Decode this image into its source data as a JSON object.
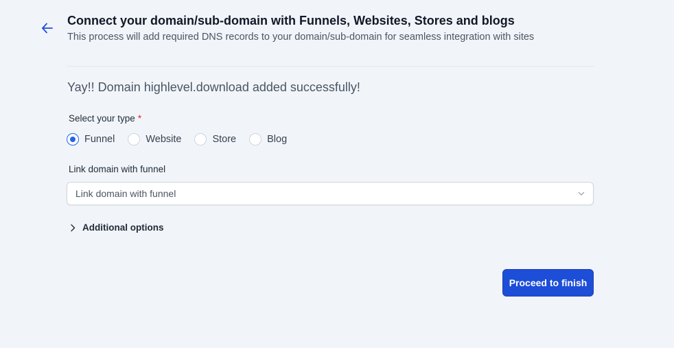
{
  "header": {
    "back_icon": "arrow-left-icon",
    "title": "Connect your domain/sub-domain with Funnels, Websites, Stores and blogs",
    "subtitle": "This process will add required DNS records to your domain/sub-domain for seamless integration with sites"
  },
  "success_message": "Yay!! Domain highlevel.download added successfully!",
  "type_select": {
    "label": "Select your type",
    "required_mark": "*",
    "options": [
      {
        "label": "Funnel",
        "selected": true
      },
      {
        "label": "Website",
        "selected": false
      },
      {
        "label": "Store",
        "selected": false
      },
      {
        "label": "Blog",
        "selected": false
      }
    ]
  },
  "link_domain": {
    "label": "Link domain with funnel",
    "placeholder": "Link domain with funnel",
    "icon": "chevron-down-icon"
  },
  "additional_options": {
    "label": "Additional options",
    "icon": "chevron-right-icon"
  },
  "actions": {
    "proceed_label": "Proceed to finish"
  },
  "colors": {
    "background": "#f1f5f9",
    "primary": "#1d4ed8",
    "required": "#dc2626"
  }
}
